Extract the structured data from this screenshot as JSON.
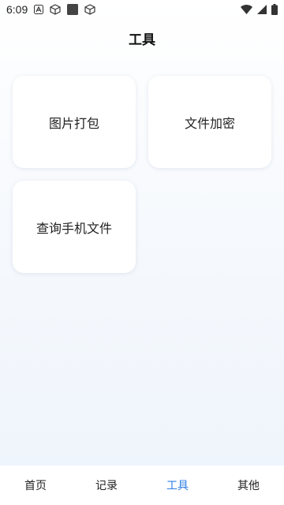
{
  "status_bar": {
    "time": "6:09",
    "icons": [
      "a-badge-icon",
      "cube-icon",
      "square-icon",
      "cube-icon",
      "wifi-icon",
      "signal-icon",
      "battery-icon"
    ]
  },
  "page": {
    "title": "工具"
  },
  "tiles": [
    {
      "label": "图片打包"
    },
    {
      "label": "文件加密"
    },
    {
      "label": "查询手机文件"
    }
  ],
  "bottom_nav": {
    "items": [
      {
        "label": "首页"
      },
      {
        "label": "记录"
      },
      {
        "label": "工具"
      },
      {
        "label": "其他"
      }
    ],
    "active_color": "#2f7fe6"
  }
}
